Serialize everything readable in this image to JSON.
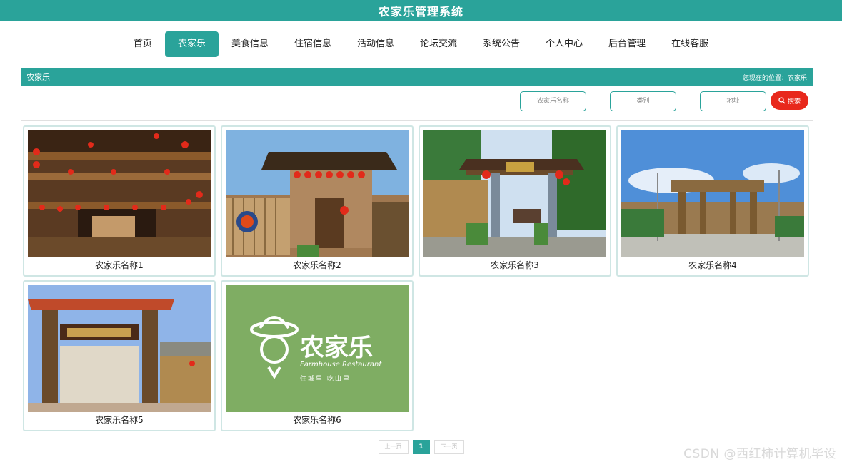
{
  "app": {
    "title": "农家乐管理系统"
  },
  "nav": [
    {
      "label": "首页"
    },
    {
      "label": "农家乐",
      "active": true
    },
    {
      "label": "美食信息"
    },
    {
      "label": "住宿信息"
    },
    {
      "label": "活动信息"
    },
    {
      "label": "论坛交流"
    },
    {
      "label": "系统公告"
    },
    {
      "label": "个人中心"
    },
    {
      "label": "后台管理"
    },
    {
      "label": "在线客服"
    }
  ],
  "crumb": {
    "section": "农家乐",
    "location": "您现在的位置：农家乐"
  },
  "search": {
    "name_placeholder": "农家乐名称",
    "type_placeholder": "类别",
    "address_placeholder": "地址",
    "button_label": "搜索"
  },
  "cards": [
    {
      "name": "农家乐名称1"
    },
    {
      "name": "农家乐名称2"
    },
    {
      "name": "农家乐名称3"
    },
    {
      "name": "农家乐名称4"
    },
    {
      "name": "农家乐名称5"
    },
    {
      "name": "农家乐名称6"
    }
  ],
  "logo": {
    "text": "农家乐",
    "subtitle": "Farmhouse Restaurant",
    "slogan": "住城里  吃山里"
  },
  "pager": {
    "prev": "上一页",
    "current": "1",
    "next": "下一页"
  },
  "watermark": "CSDN @西红柿计算机毕设",
  "colors": {
    "accent": "#2aa39a",
    "search_button": "#e8281c"
  }
}
